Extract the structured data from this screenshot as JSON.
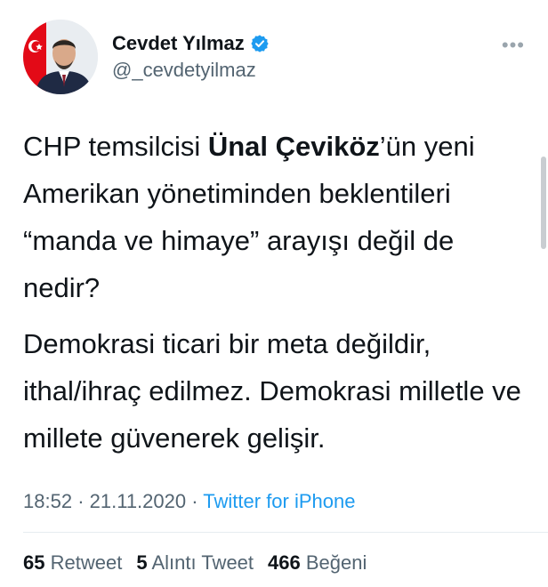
{
  "author": {
    "display_name": "Cevdet Yılmaz",
    "handle": "@_cevdetyilmaz",
    "verified": true,
    "avatar_icon": "profile-photo-icon",
    "verified_icon": "verified-badge-icon",
    "more_icon": "more-options-icon",
    "more_glyph": "•••"
  },
  "tweet": {
    "p1_a": "CHP temsilcisi ",
    "p1_bold": "Ünal Çeviköz",
    "p1_b": "’ün yeni Amerikan yönetiminden beklentileri “manda ve himaye” arayışı değil de nedir?",
    "p2": "Demokrasi ticari bir meta değildir, ithal/ihraç edilmez. Demokrasi milletle ve millete güvenerek gelişir."
  },
  "meta": {
    "time": "18:52",
    "separator": "·",
    "date": "21.11.2020",
    "source": "Twitter for iPhone"
  },
  "stats": {
    "retweets_count": "65",
    "retweets_label": "Retweet",
    "quotes_count": "5",
    "quotes_label": "Alıntı Tweet",
    "likes_count": "466",
    "likes_label": "Beğeni"
  },
  "colors": {
    "link": "#1d9bf0",
    "secondary_text": "#536471",
    "verified": "#1d9bf0"
  }
}
